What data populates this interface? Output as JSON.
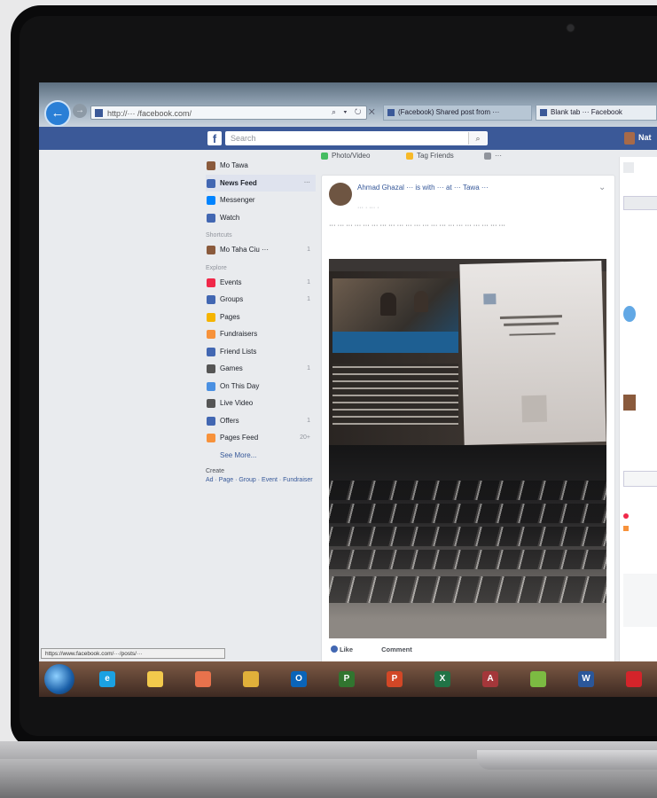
{
  "browser": {
    "url": "http://··· /facebook.com/",
    "tabs": [
      {
        "label": "(Facebook) Shared post from ···"
      },
      {
        "label": "Blank tab ··· Facebook"
      }
    ],
    "status_url": "https://www.facebook.com/···/posts/···",
    "back_icon": "back-arrow-icon",
    "forward_icon": "forward-arrow-icon"
  },
  "facebook": {
    "logo": "f",
    "search_placeholder": "Search",
    "user_name": "Nat",
    "brand_color": "#3b5998"
  },
  "left_nav": {
    "profile": "Mo Tawa",
    "items": [
      {
        "label": "News Feed",
        "count": "···",
        "active": true,
        "color": "#4267b2"
      },
      {
        "label": "Messenger",
        "count": "",
        "active": false,
        "color": "#0084ff"
      },
      {
        "label": "Watch",
        "count": "",
        "active": false,
        "color": "#4267b2"
      }
    ],
    "shortcuts_title": "Shortcuts",
    "shortcuts": [
      {
        "label": "Mo Taha Ciu ···",
        "count": "1",
        "color": "#8a5a3c"
      }
    ],
    "explore_title": "Explore",
    "explore": [
      {
        "label": "Events",
        "count": "1",
        "color": "#f02849"
      },
      {
        "label": "Groups",
        "count": "1",
        "color": "#4267b2"
      },
      {
        "label": "Pages",
        "count": "",
        "color": "#f5b400"
      },
      {
        "label": "Fundraisers",
        "count": "",
        "color": "#f7923b"
      },
      {
        "label": "Friend Lists",
        "count": "",
        "color": "#4267b2"
      },
      {
        "label": "Games",
        "count": "1",
        "color": "#555555"
      },
      {
        "label": "On This Day",
        "count": "",
        "color": "#4a90e2"
      },
      {
        "label": "Live Video",
        "count": "",
        "color": "#555555"
      },
      {
        "label": "Offers",
        "count": "1",
        "color": "#4267b2"
      },
      {
        "label": "Pages Feed",
        "count": "20+",
        "color": "#f7923b"
      }
    ],
    "see_more": "See More...",
    "create_title": "Create",
    "create_links": "Ad · Page · Group · Event · Fundraiser"
  },
  "composer": {
    "tabs": [
      {
        "label": "Photo/Video",
        "color": "#45bd62"
      },
      {
        "label": "Tag Friends",
        "color": "#f7b928"
      },
      {
        "label": "···",
        "color": "#90949c"
      }
    ]
  },
  "post": {
    "header": "Ahmad Ghazal ··· is with ··· at ··· Tawa ···",
    "time": "··· · ··· ·",
    "text": "··· ··· ··· ··· ··· ··· ··· ··· ··· ··· ··· ··· ··· ··· ··· ··· ··· ··· ··· ··· ···",
    "menu_icon": "more-icon",
    "actions": {
      "like": "Like",
      "comment": "Comment"
    }
  },
  "taskbar": {
    "apps": [
      {
        "name": "start-button-icon",
        "label": ""
      },
      {
        "name": "ie-icon",
        "label": "e",
        "color": "#1ba1e2"
      },
      {
        "name": "file-explorer-icon",
        "label": "",
        "color": "#f2c94c"
      },
      {
        "name": "app-icon",
        "label": "",
        "color": "#e8724c"
      },
      {
        "name": "chrome-icon",
        "label": "",
        "color": "#e0b03a"
      },
      {
        "name": "outlook-icon",
        "label": "O",
        "color": "#0a64b8"
      },
      {
        "name": "project-icon",
        "label": "P",
        "color": "#31752f"
      },
      {
        "name": "powerpoint-icon",
        "label": "P",
        "color": "#d24726"
      },
      {
        "name": "excel-icon",
        "label": "X",
        "color": "#217346"
      },
      {
        "name": "access-icon",
        "label": "A",
        "color": "#a4373a"
      },
      {
        "name": "green-app-icon",
        "label": "",
        "color": "#7cbb42"
      },
      {
        "name": "word-icon",
        "label": "W",
        "color": "#2b579a"
      },
      {
        "name": "acrobat-icon",
        "label": "",
        "color": "#d4242a"
      }
    ]
  }
}
